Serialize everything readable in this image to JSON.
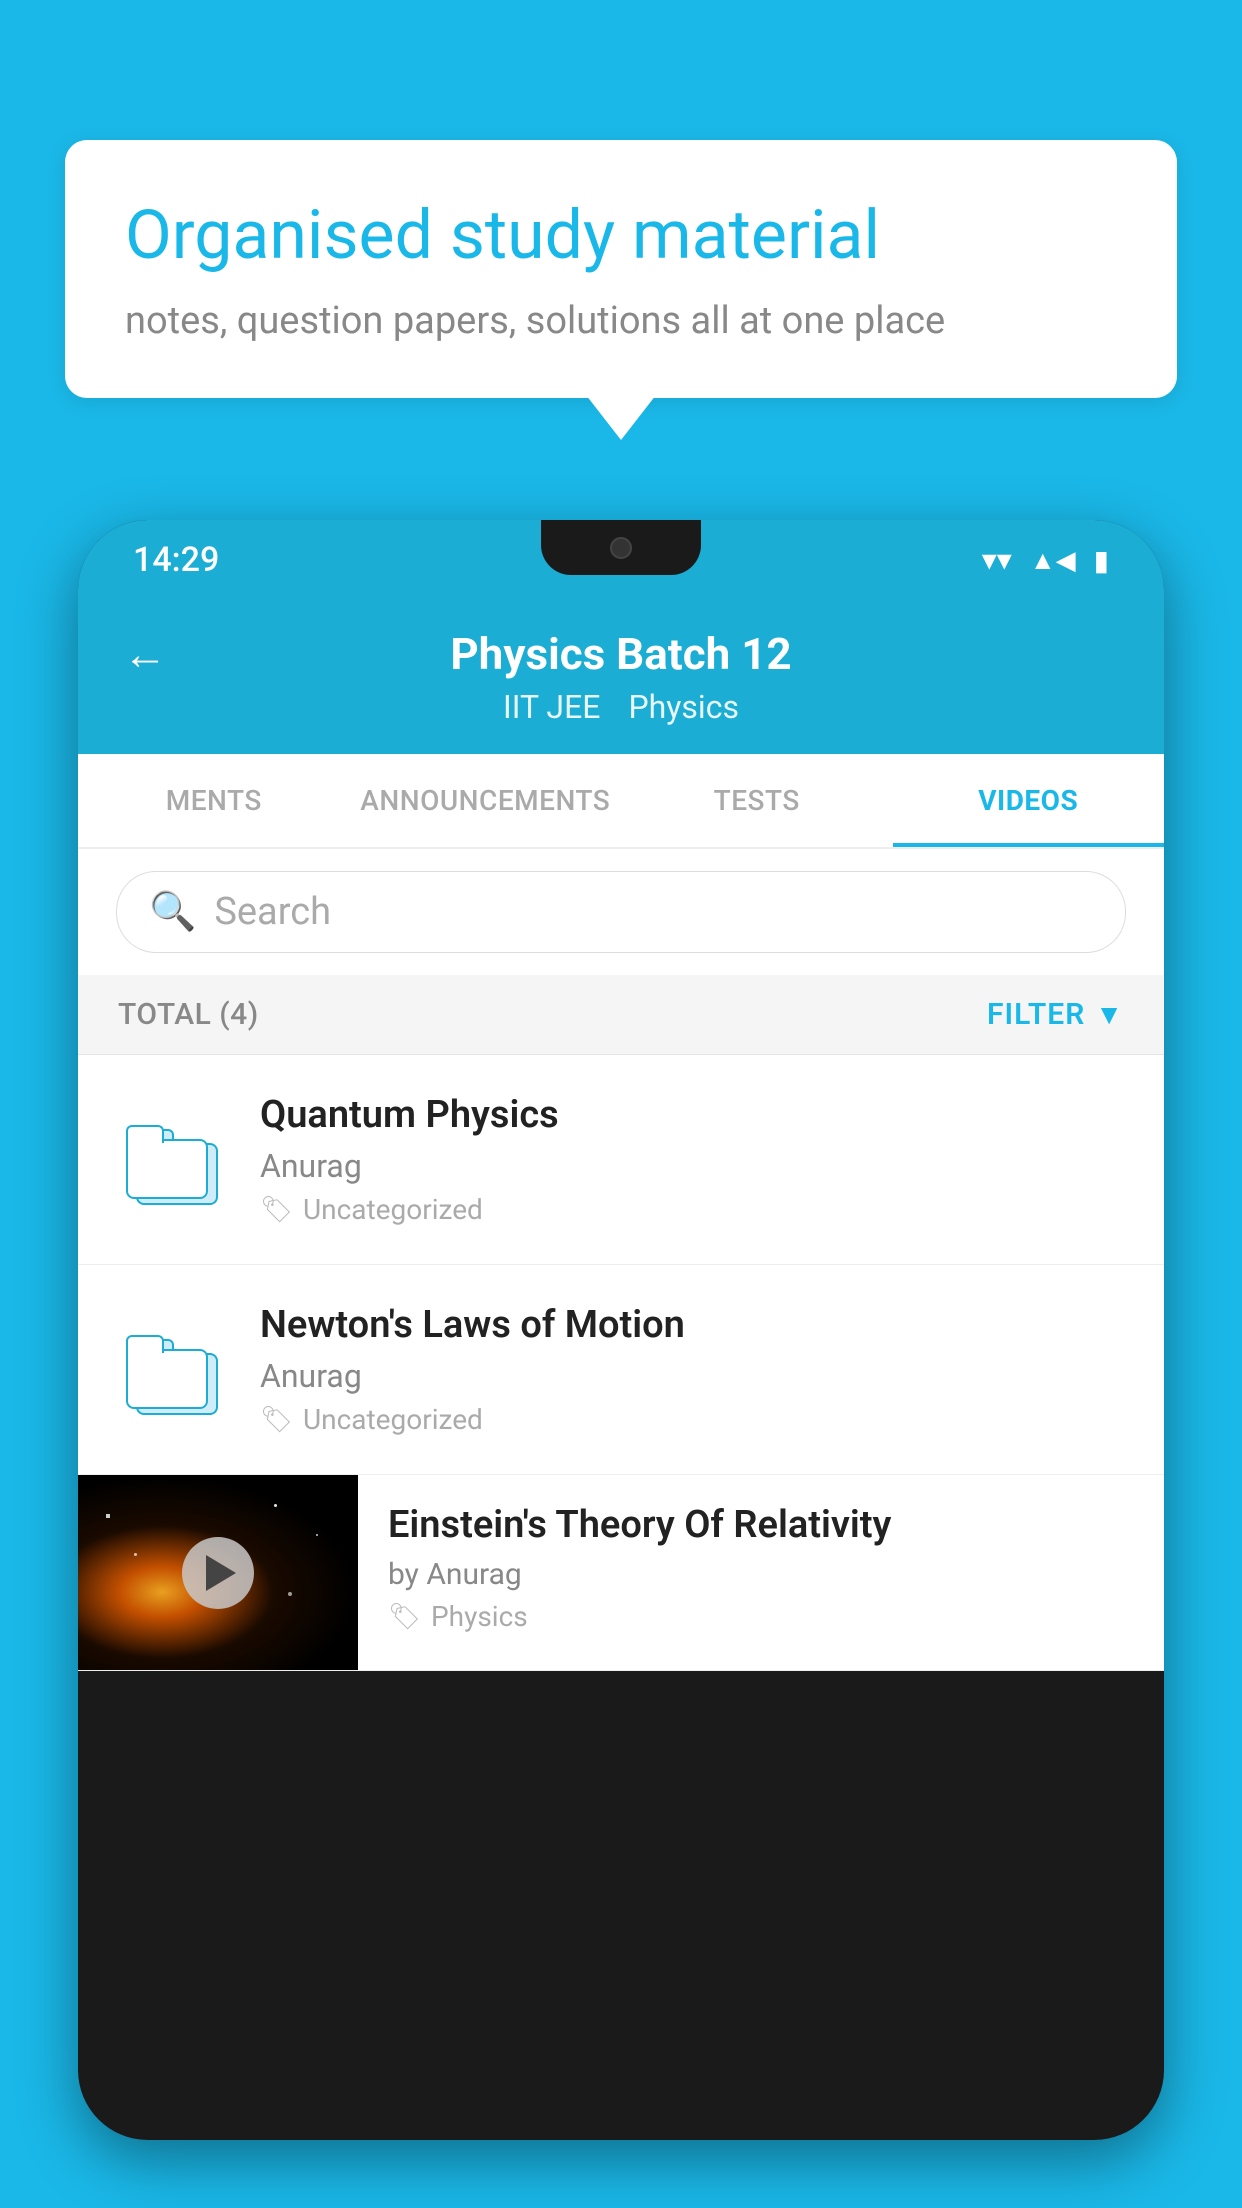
{
  "background_color": "#1ab8e8",
  "speech_bubble": {
    "title": "Organised study material",
    "subtitle": "notes, question papers, solutions all at one place"
  },
  "phone": {
    "status_bar": {
      "time": "14:29",
      "icons": [
        "wifi",
        "signal",
        "battery"
      ]
    },
    "app_header": {
      "back_label": "←",
      "title": "Physics Batch 12",
      "subtitle1": "IIT JEE",
      "subtitle2": "Physics"
    },
    "tabs": [
      {
        "label": "MENTS",
        "active": false
      },
      {
        "label": "ANNOUNCEMENTS",
        "active": false
      },
      {
        "label": "TESTS",
        "active": false
      },
      {
        "label": "VIDEOS",
        "active": true
      }
    ],
    "search": {
      "placeholder": "Search"
    },
    "filter_row": {
      "total_label": "TOTAL (4)",
      "filter_label": "FILTER"
    },
    "video_items": [
      {
        "type": "folder",
        "title": "Quantum Physics",
        "author": "Anurag",
        "tag": "Uncategorized"
      },
      {
        "type": "folder",
        "title": "Newton's Laws of Motion",
        "author": "Anurag",
        "tag": "Uncategorized"
      },
      {
        "type": "thumbnail",
        "title": "Einstein's Theory Of Relativity",
        "author": "by Anurag",
        "tag": "Physics"
      }
    ]
  }
}
